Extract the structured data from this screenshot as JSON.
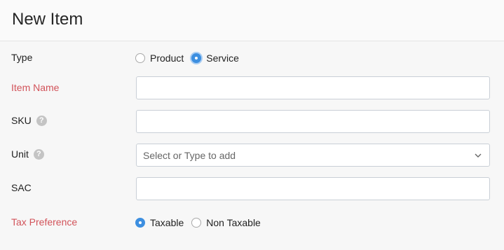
{
  "header": {
    "title": "New Item"
  },
  "form": {
    "type": {
      "label": "Type",
      "options": [
        {
          "label": "Product",
          "checked": false
        },
        {
          "label": "Service",
          "checked": true
        }
      ]
    },
    "item_name": {
      "label": "Item Name",
      "required": true,
      "value": ""
    },
    "sku": {
      "label": "SKU",
      "help_icon": "question-icon",
      "value": ""
    },
    "unit": {
      "label": "Unit",
      "help_icon": "question-icon",
      "placeholder": "Select or Type to add"
    },
    "sac": {
      "label": "SAC",
      "value": ""
    },
    "tax_preference": {
      "label": "Tax Preference",
      "required": true,
      "options": [
        {
          "label": "Taxable",
          "checked": true
        },
        {
          "label": "Non Taxable",
          "checked": false
        }
      ]
    }
  },
  "colors": {
    "accent": "#3d8fe0",
    "required_label": "#d2535a",
    "border": "#c9cfd6"
  }
}
